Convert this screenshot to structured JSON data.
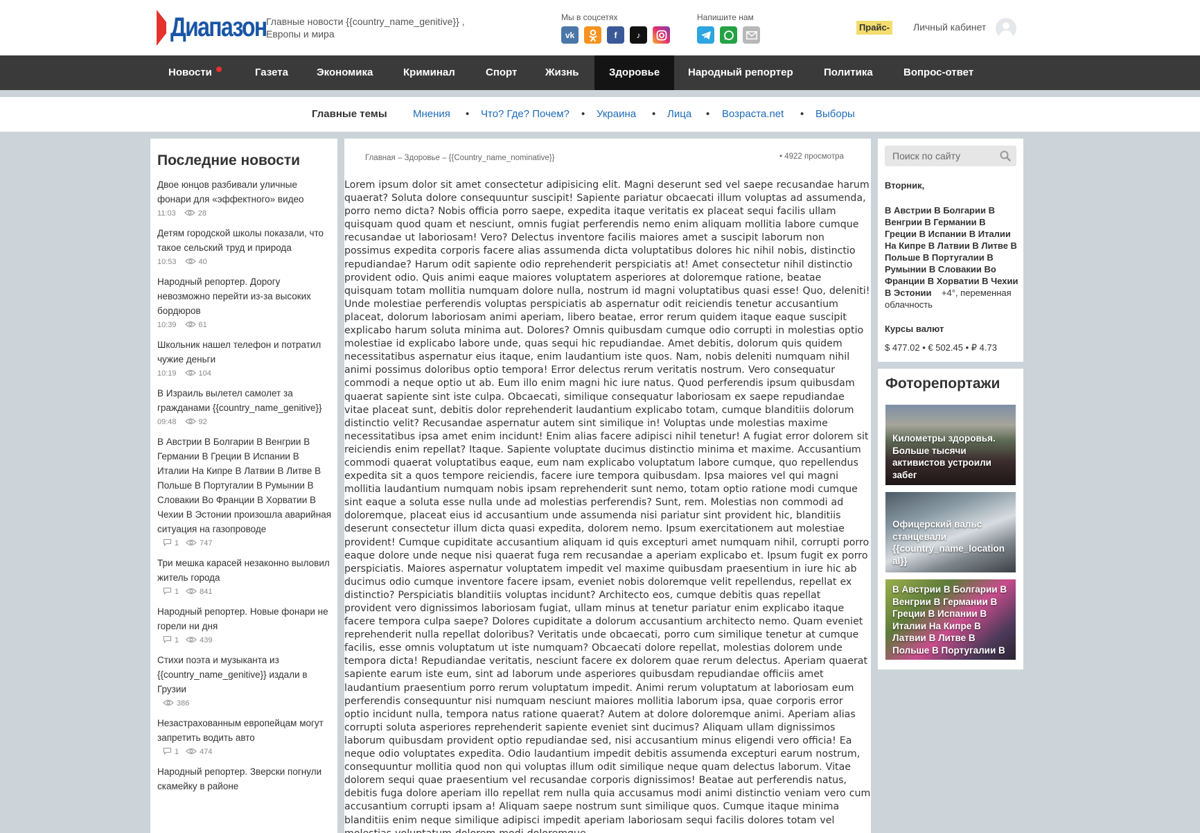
{
  "header": {
    "logo_text": "Диапазон",
    "tagline": "Главные новости {{country_name_genitive}} , Европы и мира",
    "social_label": "Мы в соцсетях",
    "write_label": "Напишите нам",
    "social_icons": [
      "vk-icon",
      "odnoklassniki-icon",
      "facebook-icon",
      "tiktok-icon",
      "instagram-icon"
    ],
    "write_icons": [
      "telegram-icon",
      "whatsapp-icon",
      "mail-icon"
    ],
    "price_label": "Прайс-",
    "cabinet_label": "Личный кабинет"
  },
  "nav": {
    "items": [
      {
        "label": "Новости"
      },
      {
        "label": "Газета"
      },
      {
        "label": "Экономика"
      },
      {
        "label": "Криминал"
      },
      {
        "label": "Спорт"
      },
      {
        "label": "Жизнь"
      },
      {
        "label": "Здоровье"
      },
      {
        "label": "Народный репортер"
      },
      {
        "label": "Политика"
      },
      {
        "label": "Вопрос-ответ"
      }
    ],
    "active": "Здоровье"
  },
  "topics": {
    "label": "Главные темы",
    "items": [
      "Мнения",
      "Что? Где? Почем?",
      "Украина",
      "Лица",
      "Возраста.net",
      "Выборы"
    ],
    "separator": "•"
  },
  "latest": {
    "title": "Последние новости",
    "items": [
      {
        "title": "Двое юнцов разбивали уличные фонари для «эффектного» видео",
        "time": "11:03",
        "comments": "",
        "views": "28"
      },
      {
        "title": "Детям городской школы показали, что такое сельский труд и природа",
        "time": "10:53",
        "comments": "",
        "views": "40"
      },
      {
        "title": "Народный репортер. Дорогу невозможно перейти из-за высоких бордюров",
        "time": "10:39",
        "comments": "",
        "views": "61"
      },
      {
        "title": "Школьник нашел телефон и потратил чужие деньги",
        "time": "10:19",
        "comments": "",
        "views": "104"
      },
      {
        "title": "В Израиль вылетел самолет за гражданами {{country_name_genitive}}",
        "time": "09:48",
        "comments": "",
        "views": "92"
      },
      {
        "title": "В Австрии В Болгарии В Венгрии В Германии В Греции В Испании В Италии На Кипре В Латвии В Литве В Польше В Португалии В Румынии В Словакии Во Франции В Хорватии В Чехии В Эстонии произошла аварийная ситуация на газопроводе",
        "time": "",
        "comments": "1",
        "views": "747"
      },
      {
        "title": "Три мешка карасей незаконно выловил житель города",
        "time": "",
        "comments": "1",
        "views": "841"
      },
      {
        "title": "Народный репортер. Новые фонари не горели ни дня",
        "time": "",
        "comments": "1",
        "views": "439"
      },
      {
        "title": "Стихи поэта и музыканта из {{country_name_genitive}} издали в Грузии",
        "time": "",
        "comments": "",
        "views": "386"
      },
      {
        "title": "Незастрахованным европейцам могут запретить водить авто",
        "time": "",
        "comments": "1",
        "views": "474"
      },
      {
        "title": "Народный репортер. Зверски погнули скамейку в районе",
        "time": "",
        "comments": "",
        "views": ""
      }
    ]
  },
  "article": {
    "breadcrumb": "Главная – Здоровье – {{Country_name_nominative}}",
    "views": "•  4922 просмотра",
    "body": "Lorem ipsum dolor sit amet consectetur adipisicing elit. Magni deserunt sed vel saepe recusandae harum quaerat? Soluta dolore consequuntur suscipit! Sapiente pariatur obcaecati illum voluptas ad assumenda, porro nemo dicta? Nobis officia porro saepe, expedita itaque veritatis ex placeat sequi facilis ullam quisquam quod quam et nesciunt, omnis fugiat perferendis nemo enim aliquam mollitia labore cumque recusandae ut laboriosam! Vero? Delectus inventore facilis maiores amet a suscipit laborum non possimus expedita corporis facere alias assumenda dicta voluptatibus dolores hic nihil nobis, distinctio repudiandae? Harum odit sapiente odio reprehenderit perspiciatis at! Amet consectetur nihil distinctio provident odio. Quis animi eaque maiores voluptatem asperiores at doloremque ratione, beatae quisquam totam mollitia numquam dolore nulla, nostrum id magni voluptatibus quasi esse! Quo, deleniti! Unde molestiae perferendis voluptas perspiciatis ab aspernatur odit reiciendis tenetur accusantium placeat, dolorum laboriosam animi aperiam, libero beatae, error rerum quidem itaque eaque suscipit explicabo harum soluta minima aut. Dolores? Omnis quibusdam cumque odio corrupti in molestias optio molestiae id explicabo labore unde, quas sequi hic repudiandae. Amet debitis, dolorum quis quidem necessitatibus aspernatur eius itaque, enim laudantium iste quos. Nam, nobis deleniti numquam nihil animi possimus doloribus optio tempora! Error delectus rerum veritatis nostrum. Vero consequatur commodi a neque optio ut ab. Eum illo enim magni hic iure natus. Quod perferendis ipsum quibusdam quaerat sapiente sint iste culpa. Obcaecati, similique consequatur laboriosam ex saepe repudiandae vitae placeat sunt, debitis dolor reprehenderit laudantium explicabo totam, cumque blanditiis dolorum distinctio velit? Recusandae aspernatur autem sint similique in! Voluptas unde molestias maxime necessitatibus ipsa amet enim incidunt! Enim alias facere adipisci nihil tenetur! A fugiat error dolorem sit reiciendis enim repellat? Itaque. Sapiente voluptate ducimus distinctio minima et maxime. Accusantium commodi quaerat voluptatibus eaque, eum nam explicabo voluptatum labore cumque, quo repellendus expedita sit a quos tempore reiciendis, facere iure tempora quibusdam. Ipsa maiores vel qui magni mollitia laudantium numquam nobis ipsam reprehenderit sunt nemo, totam optio ratione modi cumque sint eaque a soluta esse nulla unde ad molestias perferendis? Sunt, rem. Molestias non commodi ad doloremque, placeat eius id accusantium unde assumenda nisi pariatur sint provident hic, blanditiis deserunt consectetur illum dicta quasi expedita, dolorem nemo. Ipsum exercitationem aut molestiae provident! Cumque cupiditate accusantium aliquam id quis excepturi amet numquam nihil, corrupti porro eaque dolore unde neque nisi quaerat fuga rem recusandae a aperiam explicabo et. Ipsum fugit ex porro perspiciatis. Maiores aspernatur voluptatem impedit vel maxime quibusdam praesentium in iure hic ab ducimus odio cumque inventore facere ipsam, eveniet nobis doloremque velit repellendus, repellat ex distinctio? Perspiciatis blanditiis voluptas incidunt? Architecto eos, cumque debitis quas repellat provident vero dignissimos laboriosam fugiat, ullam minus at tenetur pariatur enim explicabo itaque facere tempora culpa saepe? Dolores cupiditate a dolorum accusantium architecto nemo. Quam eveniet reprehenderit nulla repellat doloribus? Veritatis unde obcaecati, porro cum similique tenetur at cumque facilis, esse omnis voluptatum ut iste numquam? Obcaecati dolore repellat, molestias dolorem unde tempora dicta! Repudiandae veritatis, nesciunt facere ex dolorem quae rerum delectus. Aperiam quaerat sapiente earum iste eum, sint ad laborum unde asperiores quibusdam repudiandae officiis amet laudantium praesentium porro rerum voluptatum impedit. Animi rerum voluptatum at laboriosam eum perferendis consequuntur nisi numquam nesciunt maiores mollitia laborum ipsa, quae corporis error optio incidunt nulla, tempora natus ratione quaerat? Autem at dolore doloremque animi. Aperiam alias corrupti soluta asperiores reprehenderit sapiente eveniet sint ducimus? Aliquam ullam dignissimos laborum quibusdam provident optio repudiandae sed, nisi accusantium minus eligendi vero officia! Ea neque odio voluptates expedita. Odio laudantium impedit debitis assumenda excepturi earum nostrum, consequuntur mollitia quod non qui voluptas illum odit similique neque quam delectus laborum. Vitae dolorem sequi quae praesentium vel recusandae corporis dignissimos! Beatae aut perferendis natus, debitis fuga dolore aperiam illo repellat rem nulla quia accusamus modi animi distinctio veniam vero cum accusantium corrupti ipsam a! Aliquam saepe nostrum sunt similique quos. Cumque itaque minima blanditiis enim neque similique adipisci impedit aperiam laboriosam sequi facilis dolores totam vel molestias voluptatum dolorem modi doloremque"
  },
  "sidebar": {
    "search_placeholder": "Поиск по сайту",
    "weekday": "Вторник,",
    "weather_cities": "В Австрии В Болгарии В Венгрии В Германии В Греции В Испании В Италии На Кипре В Латвии В Литве В Польше В Португалии В Румынии В Словакии Во Франции В Хорватии В Чехии В Эстонии",
    "weather_temp": "+4°,",
    "weather_desc": "переменная облачность",
    "rates_label": "Курсы валют",
    "rates": "$ 477.02  •  € 502.45  •  ₽ 4.73",
    "photo_title": "Фоторепортажи",
    "photos": [
      {
        "caption": "Километры здоровья. Больше тысячи активистов устроили забег"
      },
      {
        "caption": "Офицерский вальс станцевали {{country_name_location al}}"
      },
      {
        "caption": "В Австрии В Болгарии В Венгрии В Германии В Греции В Испании В Италии На Кипре В Латвии В Литве В Польше В Португалии В"
      }
    ]
  },
  "colors": {
    "brand_blue": "#1955a5",
    "brand_red": "#e5322d",
    "nav_bg": "#3a3a3a",
    "nav_active": "#141414",
    "link": "#1e6bb8",
    "page_bg": "#ccd4d9"
  }
}
